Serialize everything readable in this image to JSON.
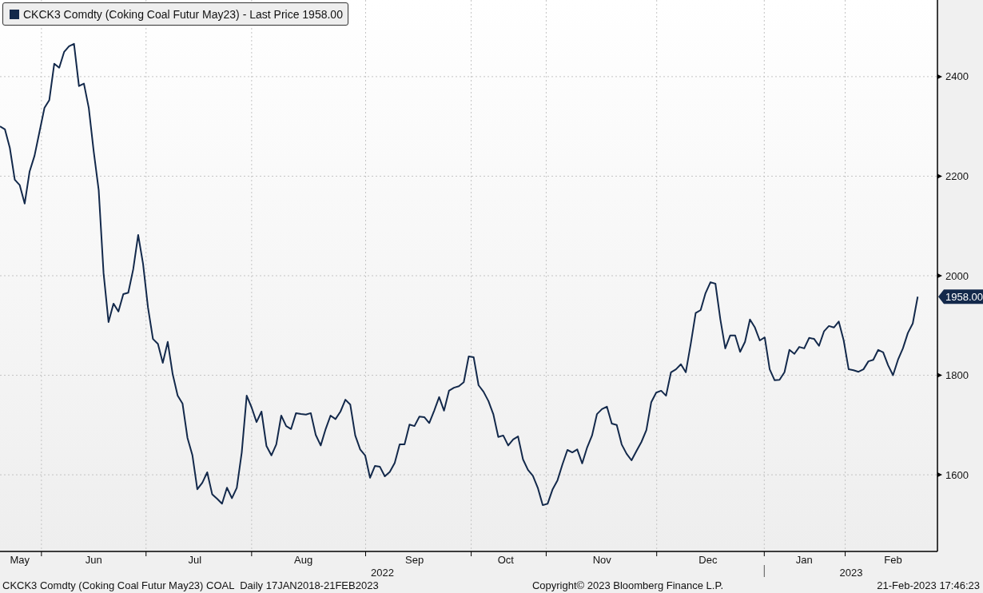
{
  "chart": {
    "last_value_label": "1958.00",
    "time_axis": {
      "month_labels": [
        "May",
        "Jun",
        "Jul",
        "Aug",
        "Sep",
        "Oct",
        "Nov",
        "Dec",
        "Jan",
        "Feb"
      ],
      "year_labels": [
        "2022",
        "2023"
      ]
    },
    "chart_data": {
      "type": "line",
      "grid": true,
      "ylim": [
        1446,
        2554
      ],
      "yticks": [
        1600,
        1800,
        2000,
        2200,
        2400
      ],
      "series": [
        {
          "name": "CKCK3 Comdty (Coking Coal Futur May23) - Last Price 1958.00",
          "color": "#13294b",
          "values": [
            2300,
            2294,
            2257,
            2193,
            2182,
            2145,
            2209,
            2241,
            2289,
            2337,
            2353,
            2426,
            2418,
            2450,
            2461,
            2466,
            2381,
            2386,
            2337,
            2249,
            2172,
            2005,
            1907,
            1944,
            1928,
            1963,
            1966,
            2013,
            2082,
            2024,
            1936,
            1873,
            1863,
            1825,
            1867,
            1802,
            1759,
            1743,
            1674,
            1639,
            1571,
            1584,
            1605,
            1561,
            1552,
            1542,
            1574,
            1553,
            1574,
            1645,
            1759,
            1735,
            1706,
            1727,
            1658,
            1639,
            1661,
            1719,
            1698,
            1692,
            1724,
            1722,
            1721,
            1724,
            1680,
            1659,
            1692,
            1719,
            1712,
            1727,
            1751,
            1741,
            1679,
            1651,
            1639,
            1594,
            1618,
            1616,
            1597,
            1606,
            1624,
            1661,
            1661,
            1701,
            1698,
            1717,
            1716,
            1704,
            1729,
            1756,
            1729,
            1769,
            1775,
            1778,
            1786,
            1838,
            1836,
            1780,
            1767,
            1748,
            1721,
            1676,
            1679,
            1659,
            1671,
            1677,
            1631,
            1610,
            1598,
            1574,
            1539,
            1542,
            1571,
            1589,
            1621,
            1650,
            1645,
            1651,
            1623,
            1655,
            1679,
            1722,
            1732,
            1737,
            1703,
            1700,
            1661,
            1642,
            1629,
            1648,
            1666,
            1690,
            1746,
            1765,
            1769,
            1759,
            1806,
            1812,
            1822,
            1806,
            1863,
            1925,
            1931,
            1965,
            1987,
            1984,
            1912,
            1854,
            1880,
            1880,
            1847,
            1867,
            1912,
            1896,
            1870,
            1876,
            1812,
            1790,
            1791,
            1806,
            1851,
            1843,
            1857,
            1854,
            1875,
            1873,
            1859,
            1888,
            1899,
            1896,
            1908,
            1870,
            1812,
            1810,
            1807,
            1812,
            1828,
            1831,
            1851,
            1846,
            1820,
            1800,
            1831,
            1854,
            1885,
            1904,
            1958
          ]
        }
      ]
    }
  },
  "footer": {
    "description": "CKCK3 Comdty (Coking Coal Futur May23) COAL  Daily 17JAN2018-21FEB2023",
    "copyright": "Copyright© 2023 Bloomberg Finance L.P.",
    "timestamp": "21-Feb-2023 17:46:23"
  }
}
